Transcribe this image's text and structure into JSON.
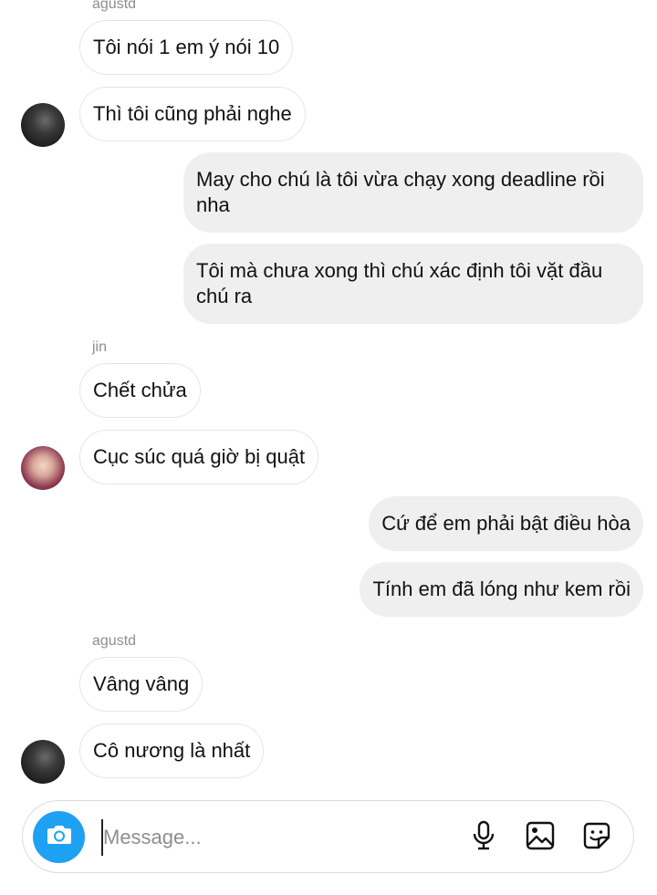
{
  "conversation": {
    "sender_1_name_a": "agustd",
    "sender_2_name": "jin",
    "sender_1_name_b": "agustd",
    "messages": [
      {
        "text": "Tôi nói 1 em ý nói 10"
      },
      {
        "text": "Thì tôi cũng phải nghe"
      },
      {
        "text": "May cho chú là tôi vừa chạy xong deadline rồi nha"
      },
      {
        "text": "Tôi mà chưa xong thì chú xác định tôi vặt đầu chú ra"
      },
      {
        "text": "Chết chửa"
      },
      {
        "text": "Cục súc quá giờ bị quật"
      },
      {
        "text": "Cứ để em phải bật điều hòa"
      },
      {
        "text": "Tính em đã lóng như kem rồi"
      },
      {
        "text": "Vâng vâng"
      },
      {
        "text": "Cô nương là nhất"
      }
    ]
  },
  "composer": {
    "placeholder": "Message...",
    "camera_icon": "camera-icon",
    "mic_icon": "microphone-icon",
    "gallery_icon": "image-icon",
    "sticker_icon": "sticker-icon",
    "accent_color": "#1ea1f2"
  }
}
